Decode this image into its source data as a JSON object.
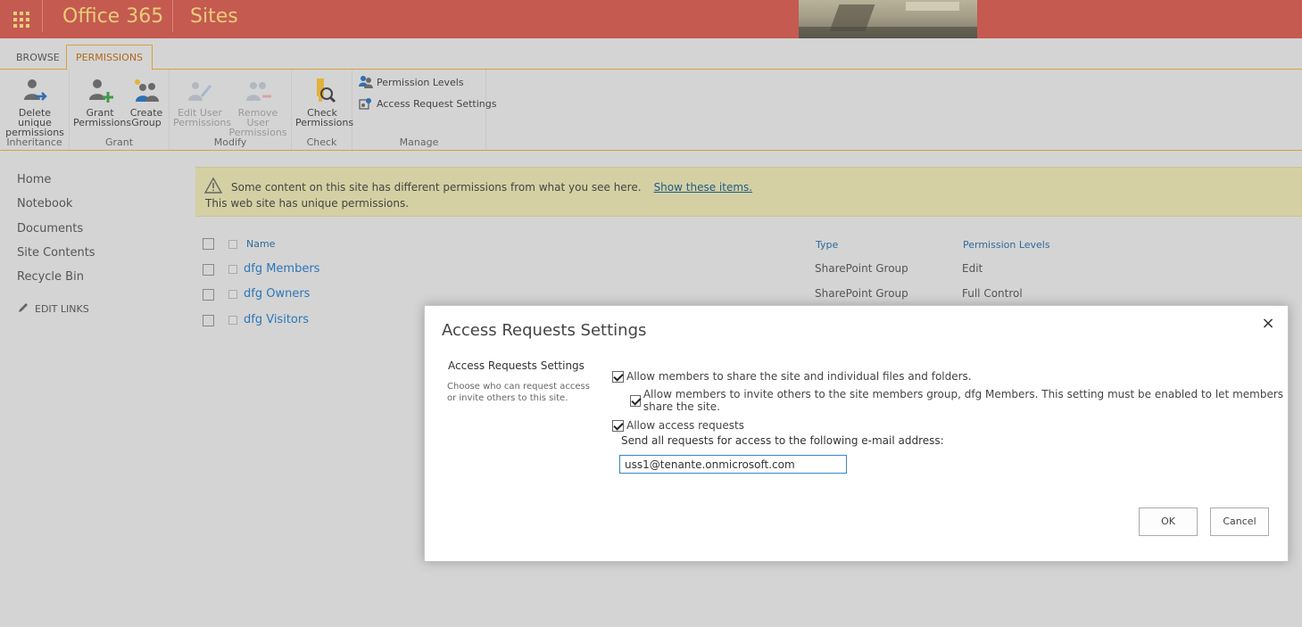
{
  "suite": {
    "app_name": "Office 365",
    "section": "Sites"
  },
  "tabs": [
    {
      "label": "BROWSE"
    },
    {
      "label": "PERMISSIONS"
    }
  ],
  "ribbon": {
    "groups": [
      {
        "label": "Inheritance",
        "buttons": [
          {
            "line1": "Delete unique",
            "line2": "permissions"
          }
        ]
      },
      {
        "label": "Grant",
        "buttons": [
          {
            "line1": "Grant",
            "line2": "Permissions"
          },
          {
            "line1": "Create",
            "line2": "Group"
          }
        ]
      },
      {
        "label": "Modify",
        "buttons": [
          {
            "line1": "Edit User",
            "line2": "Permissions"
          },
          {
            "line1": "Remove User",
            "line2": "Permissions"
          }
        ]
      },
      {
        "label": "Check",
        "buttons": [
          {
            "line1": "Check",
            "line2": "Permissions"
          }
        ]
      },
      {
        "label": "Manage",
        "buttons": [
          {
            "label": "Permission Levels"
          },
          {
            "label": "Access Request Settings"
          }
        ]
      }
    ]
  },
  "leftnav": {
    "items": [
      "Home",
      "Notebook",
      "Documents",
      "Site Contents",
      "Recycle Bin"
    ],
    "edit_links": "EDIT LINKS"
  },
  "status": {
    "line1": "Some content on this site has different permissions from what you see here.",
    "link": "Show these items.",
    "line2": "This web site has unique permissions."
  },
  "table": {
    "headers": {
      "name": "Name",
      "type": "Type",
      "permission_levels": "Permission Levels"
    },
    "rows": [
      {
        "name": "dfg Members",
        "type": "SharePoint Group",
        "permission": "Edit"
      },
      {
        "name": "dfg Owners",
        "type": "SharePoint Group",
        "permission": "Full Control"
      },
      {
        "name": "dfg Visitors",
        "type": "",
        "permission": ""
      }
    ]
  },
  "dialog": {
    "title": "Access Requests Settings",
    "close": "×",
    "section_title": "Access Requests Settings",
    "section_desc": "Choose who can request access or invite others to this site.",
    "opt_share": "Allow members to share the site and individual files and folders.",
    "opt_invite": "Allow members to invite others to the site members group, dfg Members. This setting must be enabled to let members share the site.",
    "opt_access": "Allow access requests",
    "email_label": "Send all requests for access to the following e-mail address:",
    "email_value": "uss1@tenante.onmicrosoft.com",
    "ok": "OK",
    "cancel": "Cancel"
  },
  "colors": {
    "suite_bar": "#c55a50",
    "suite_text": "#e8cc78",
    "accent": "#d7a13b",
    "link": "#2b77b8",
    "status_bar": "#d4d0a3"
  }
}
